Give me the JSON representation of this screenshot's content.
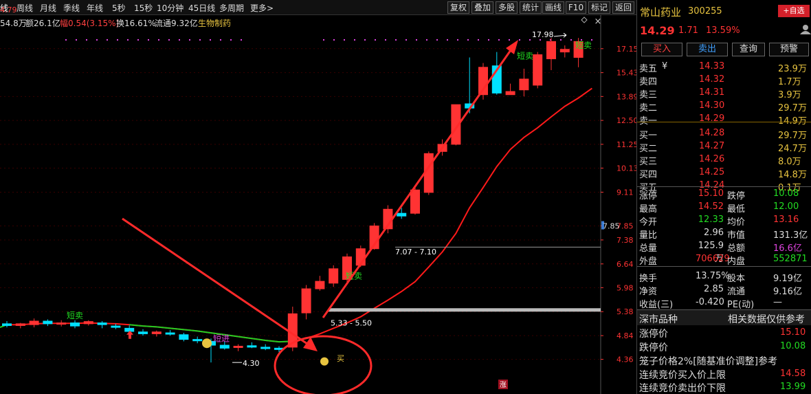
{
  "periods": [
    "线",
    "周线",
    "月线",
    "季线",
    "年线",
    "5秒",
    "15秒",
    "10分钟",
    "45日线",
    "多周期",
    "更多>"
  ],
  "tools": [
    "复权",
    "叠加",
    "多股",
    "统计",
    "画线",
    "F10",
    "标记",
    "返回"
  ],
  "info": {
    "price": "4.79",
    "vol": "54.8万",
    "amount_label": "额26.1亿",
    "amp_label": "幅0.54(3.15%)",
    "turnover_label": "换16.61%",
    "float_label": "流通9.32亿",
    "sector": "生物制药"
  },
  "colors": {
    "up": "#ff3333",
    "down": "#00e0ff",
    "ma": "#ff1a1a",
    "ma_green": "#22cc22",
    "annot": "#ff2a2a",
    "bg": "#000000",
    "grid": "#3a0000"
  },
  "chart_data": {
    "type": "candlestick",
    "ylim": [
      4.0,
      18.6
    ],
    "y_ticks": [
      "17.15",
      "15.43",
      "13.89",
      "12.50",
      "11.25",
      "10.13",
      "9.11",
      "7.85",
      "7.38",
      "6.64",
      "5.98",
      "5.38",
      "4.84",
      "4.36"
    ],
    "candles": [
      {
        "o": 5.1,
        "h": 5.16,
        "l": 5.02,
        "c": 5.06
      },
      {
        "o": 5.06,
        "h": 5.12,
        "l": 5.0,
        "c": 5.1
      },
      {
        "o": 5.08,
        "h": 5.22,
        "l": 5.02,
        "c": 5.16
      },
      {
        "o": 5.16,
        "h": 5.2,
        "l": 5.05,
        "c": 5.1
      },
      {
        "o": 5.1,
        "h": 5.18,
        "l": 5.04,
        "c": 5.12
      },
      {
        "o": 5.12,
        "h": 5.18,
        "l": 5.0,
        "c": 5.05
      },
      {
        "o": 5.1,
        "h": 5.18,
        "l": 5.06,
        "c": 5.15
      },
      {
        "o": 5.12,
        "h": 5.16,
        "l": 5.0,
        "c": 5.08
      },
      {
        "o": 5.05,
        "h": 5.1,
        "l": 4.98,
        "c": 5.02
      },
      {
        "o": 5.0,
        "h": 5.06,
        "l": 4.9,
        "c": 4.93
      },
      {
        "o": 4.92,
        "h": 4.98,
        "l": 4.84,
        "c": 4.88
      },
      {
        "o": 4.88,
        "h": 4.95,
        "l": 4.82,
        "c": 4.92
      },
      {
        "o": 4.9,
        "h": 4.96,
        "l": 4.84,
        "c": 4.87
      },
      {
        "o": 4.86,
        "h": 4.9,
        "l": 4.72,
        "c": 4.76
      },
      {
        "o": 4.76,
        "h": 4.82,
        "l": 4.68,
        "c": 4.73
      },
      {
        "o": 4.72,
        "h": 4.78,
        "l": 4.3,
        "c": 4.64
      },
      {
        "o": 4.64,
        "h": 4.72,
        "l": 4.55,
        "c": 4.58
      },
      {
        "o": 4.6,
        "h": 4.66,
        "l": 4.52,
        "c": 4.62
      },
      {
        "o": 4.63,
        "h": 4.7,
        "l": 4.58,
        "c": 4.6
      },
      {
        "o": 4.6,
        "h": 4.66,
        "l": 4.54,
        "c": 4.57
      },
      {
        "o": 4.58,
        "h": 4.62,
        "l": 4.5,
        "c": 4.56
      },
      {
        "o": 4.6,
        "h": 5.5,
        "l": 4.52,
        "c": 5.33
      },
      {
        "o": 5.35,
        "h": 6.05,
        "l": 5.2,
        "c": 5.95
      },
      {
        "o": 5.95,
        "h": 6.3,
        "l": 5.9,
        "c": 6.15
      },
      {
        "o": 6.1,
        "h": 6.6,
        "l": 6.0,
        "c": 6.5
      },
      {
        "o": 6.2,
        "h": 6.95,
        "l": 6.1,
        "c": 6.85
      },
      {
        "o": 6.6,
        "h": 7.2,
        "l": 6.55,
        "c": 7.1
      },
      {
        "o": 7.1,
        "h": 7.95,
        "l": 7.07,
        "c": 7.85
      },
      {
        "o": 7.75,
        "h": 8.6,
        "l": 7.6,
        "c": 8.45
      },
      {
        "o": 8.3,
        "h": 8.5,
        "l": 8.1,
        "c": 8.2
      },
      {
        "o": 8.3,
        "h": 9.4,
        "l": 8.25,
        "c": 9.2
      },
      {
        "o": 9.1,
        "h": 10.9,
        "l": 9.0,
        "c": 10.8
      },
      {
        "o": 10.9,
        "h": 11.5,
        "l": 10.7,
        "c": 11.25
      },
      {
        "o": 11.25,
        "h": 13.4,
        "l": 11.2,
        "c": 13.4
      },
      {
        "o": 13.45,
        "h": 16.5,
        "l": 12.9,
        "c": 13.2
      },
      {
        "o": 14.0,
        "h": 16.1,
        "l": 13.7,
        "c": 15.8
      },
      {
        "o": 15.9,
        "h": 16.9,
        "l": 14.0,
        "c": 14.1
      },
      {
        "o": 14.0,
        "h": 14.7,
        "l": 14.0,
        "c": 14.2
      },
      {
        "o": 14.3,
        "h": 15.7,
        "l": 13.9,
        "c": 15.0
      },
      {
        "o": 14.6,
        "h": 16.9,
        "l": 14.4,
        "c": 16.7
      },
      {
        "o": 16.4,
        "h": 17.98,
        "l": 15.6,
        "c": 17.7
      },
      {
        "o": 16.9,
        "h": 17.4,
        "l": 16.5,
        "c": 17.1
      },
      {
        "o": 16.5,
        "h": 17.98,
        "l": 15.8,
        "c": 17.7
      }
    ],
    "ma": [
      5.08,
      5.08,
      5.1,
      5.11,
      5.11,
      5.11,
      5.12,
      5.11,
      5.1,
      5.08,
      5.05,
      5.03,
      5.0,
      4.97,
      4.94,
      4.9,
      4.86,
      4.82,
      4.78,
      4.74,
      4.71,
      4.72,
      4.78,
      4.88,
      5.0,
      5.12,
      5.26,
      5.46,
      5.66,
      5.88,
      6.14,
      6.55,
      7.0,
      7.6,
      8.5,
      9.3,
      10.2,
      11.0,
      11.6,
      12.1,
      12.7,
      13.3,
      13.8,
      14.4
    ],
    "labels": {
      "sell_short": "短卖",
      "buy_short": "短进",
      "buy_ad": "买",
      "range1": "5.33 - 5.50",
      "range2": "7.07 - 7.10",
      "low": "4.30",
      "high": "17.98",
      "zhang": "涨",
      "x": "×"
    }
  },
  "stock": {
    "name": "常山药业",
    "code": "300255",
    "add_btn": "+自选",
    "price": "14.29",
    "change": "1.71",
    "pct": "13.59%"
  },
  "trade_buttons": [
    "买入",
    "卖出",
    "查询",
    "预警"
  ],
  "orderbook": [
    {
      "label": "卖五",
      "mark": "¥",
      "price": "14.33",
      "vol": "23.9万"
    },
    {
      "label": "卖四",
      "mark": "",
      "price": "14.32",
      "vol": "1.7万"
    },
    {
      "label": "卖三",
      "mark": "",
      "price": "14.31",
      "vol": "3.9万"
    },
    {
      "label": "卖二",
      "mark": "",
      "price": "14.30",
      "vol": "29.7万"
    },
    {
      "label": "卖一",
      "mark": "",
      "price": "14.29",
      "vol": "14.9万"
    },
    {
      "label": "买一",
      "mark": "",
      "price": "14.28",
      "vol": "29.7万"
    },
    {
      "label": "买二",
      "mark": "",
      "price": "14.27",
      "vol": "24.7万"
    },
    {
      "label": "买三",
      "mark": "",
      "price": "14.26",
      "vol": "8.0万"
    },
    {
      "label": "买四",
      "mark": "",
      "price": "14.25",
      "vol": "14.8万"
    },
    {
      "label": "买五",
      "mark": "",
      "price": "14.24",
      "vol": "0.1万"
    }
  ],
  "stats": [
    {
      "l": "涨停",
      "v": "15.10",
      "l2": "跌停",
      "v2": "10.08"
    },
    {
      "l": "最高",
      "v": "14.52",
      "l2": "最低",
      "v2": "12.00"
    },
    {
      "l": "今开",
      "v": "12.33",
      "l2": "均价",
      "v2": "13.16"
    },
    {
      "l": "量比",
      "v": "2.96",
      "l2": "市值",
      "v2": "131.3亿"
    },
    {
      "l": "总量",
      "v": "125.9万",
      "l2": "总额",
      "v2": "16.6亿"
    },
    {
      "l": "外盘",
      "v": "706629",
      "l2": "内盘",
      "v2": "552871"
    },
    {
      "l": "换手",
      "v": "13.75%",
      "l2": "股本",
      "v2": "9.19亿"
    },
    {
      "l": "净资",
      "v": "2.85",
      "l2": "流通",
      "v2": "9.16亿"
    },
    {
      "l": "收益(三)",
      "v": "-0.420",
      "l2": "PE(动)",
      "v2": "—"
    }
  ],
  "bottom": {
    "market_title": "深市品种",
    "disclaimer": "相关数据仅供参考",
    "limit_up_label": "涨停价",
    "limit_up": "15.10",
    "limit_down_label": "跌停价",
    "limit_down": "10.08",
    "cage": "笼子价格2%[随基准价调整]参考",
    "cont_up_label": "连续竞价买入价上限",
    "cont_up": "14.58",
    "cont_down_label": "连续竞价卖出价下限",
    "cont_down": "13.99"
  }
}
